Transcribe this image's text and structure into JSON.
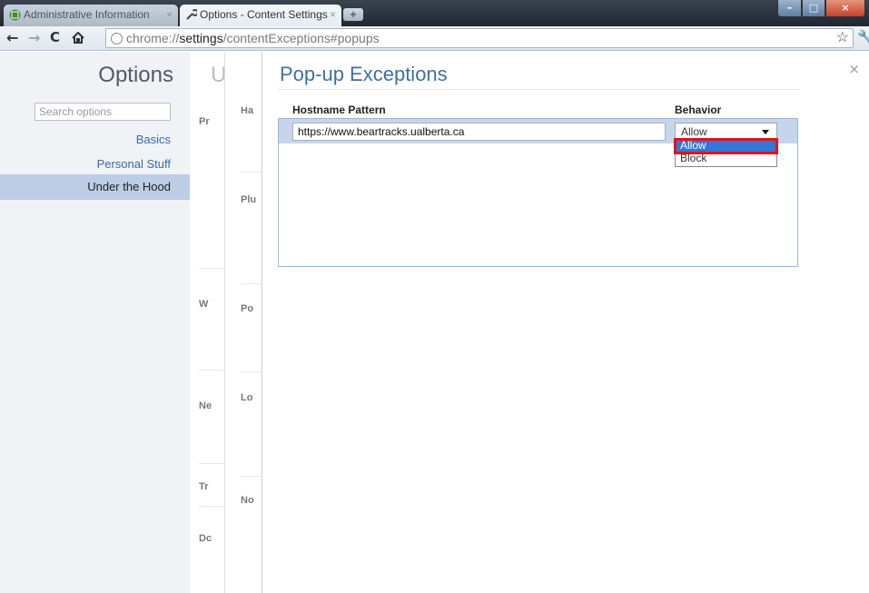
{
  "tabs": [
    {
      "label": "Administrative Information",
      "active": false
    },
    {
      "label": "Options - Content Settings",
      "active": true
    }
  ],
  "toolbar": {
    "url_scheme": "chrome://",
    "url_host": "settings",
    "url_path": "/contentExceptions#popups"
  },
  "sidebar": {
    "title": "Options",
    "search_placeholder": "Search options",
    "items": [
      {
        "label": "Basics",
        "selected": false
      },
      {
        "label": "Personal Stuff",
        "selected": false
      },
      {
        "label": "Under the Hood",
        "selected": true
      }
    ]
  },
  "background_page": {
    "title_fragment": "U",
    "left_fragments": [
      "Pr",
      "W",
      "Ne",
      "Tr",
      "Dc"
    ],
    "right_fragments": [
      "Ha",
      "Plu",
      "Po",
      "Lo",
      "No"
    ]
  },
  "dialog": {
    "title": "Pop-up Exceptions",
    "close_glyph": "×",
    "column_hostname": "Hostname Pattern",
    "column_behavior": "Behavior",
    "rows": [
      {
        "hostname": "https://www.beartracks.ualberta.ca",
        "behavior": "Allow"
      }
    ],
    "behavior_options": [
      "Allow",
      "Block"
    ],
    "highlighted_option": "Allow"
  },
  "colors": {
    "accent": "#3f6fa5",
    "selected_row": "#c6d5ea",
    "dropdown_highlight": "#3178d8",
    "annotation_box": "#e0121c"
  },
  "icons": [
    "favicon-admin-icon",
    "wrench-icon",
    "close-tab-icon",
    "new-tab-icon",
    "back-icon",
    "forward-icon",
    "reload-icon",
    "home-icon",
    "globe-icon",
    "star-icon",
    "wrench-menu-icon",
    "close-icon",
    "dropdown-arrow-icon"
  ]
}
